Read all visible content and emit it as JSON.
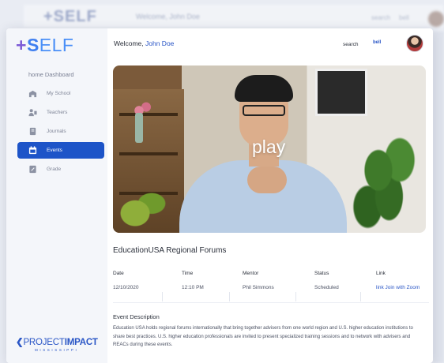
{
  "background": {
    "logo": "+SELF",
    "welcome": "Welcome, John Doe",
    "search": "search",
    "bell": "bell"
  },
  "sidebar": {
    "logo_plus": "+",
    "logo_s": "S",
    "logo_elf": "ELF",
    "home_label": "home Dashboard",
    "items": [
      {
        "label": "My School",
        "icon": "school-icon",
        "active": false
      },
      {
        "label": "Teachers",
        "icon": "teachers-icon",
        "active": false
      },
      {
        "label": "Journals",
        "icon": "journal-icon",
        "active": false
      },
      {
        "label": "Events",
        "icon": "events-icon",
        "active": true
      },
      {
        "label": "Grade",
        "icon": "grade-icon",
        "active": false
      }
    ],
    "brand_project": "PROJECT",
    "brand_impact": "IMPACT",
    "brand_state": "MISSISSIPPI"
  },
  "header": {
    "welcome_prefix": "Welcome,",
    "user_name": "John Doe",
    "search_label": "search",
    "bell_label": "bell"
  },
  "video": {
    "play_label": "play"
  },
  "event": {
    "title": "EducationUSA Regional Forums",
    "columns": [
      "Date",
      "Time",
      "Mentor",
      "Status",
      "Link"
    ],
    "date": "12/10/2020",
    "time": "12:10 PM",
    "mentor": "Phil Simmons",
    "status": "Scheduled",
    "link": "link Join with Zoom",
    "description_title": "Event Description",
    "description": "Education USA holds regional forums internationally that bring together advisers from one world region and U.S. higher education institutions to share best practices. U.S. higher education professionals are invited to present specialized training sessions and to network with advisers and REACs during these events."
  },
  "colors": {
    "accent": "#1d54c8",
    "link": "#2a56c6",
    "sidebar_bg": "#f4f6fa"
  }
}
